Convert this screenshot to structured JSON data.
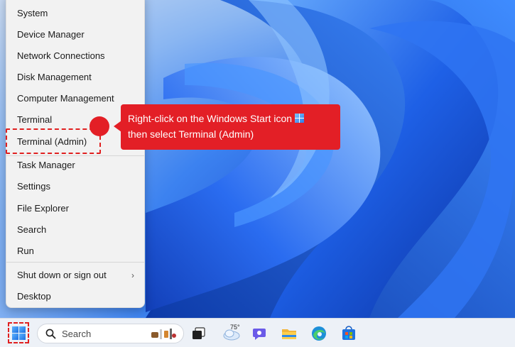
{
  "context_menu": {
    "items": [
      {
        "label": "System"
      },
      {
        "label": "Device Manager"
      },
      {
        "label": "Network Connections"
      },
      {
        "label": "Disk Management"
      },
      {
        "label": "Computer Management"
      },
      {
        "label": "Terminal"
      },
      {
        "label": "Terminal (Admin)"
      },
      {
        "label": "Task Manager"
      },
      {
        "label": "Settings"
      },
      {
        "label": "File Explorer"
      },
      {
        "label": "Search"
      },
      {
        "label": "Run"
      },
      {
        "label": "Shut down or sign out"
      },
      {
        "label": "Desktop"
      }
    ],
    "submenu_chevron": "›"
  },
  "callout": {
    "line1": "Right-click on the Windows Start icon",
    "line2": "then select Terminal (Admin)"
  },
  "taskbar": {
    "search_placeholder": "Search",
    "weather_temp": "75°",
    "icons": [
      "start-icon",
      "search-icon",
      "task-view-icon",
      "weather-icon",
      "chat-icon",
      "file-explorer-icon",
      "edge-icon",
      "store-icon"
    ]
  },
  "colors": {
    "callout": "#e31f26",
    "highlight": "#e02020",
    "wallpaper": "#2155d6"
  }
}
